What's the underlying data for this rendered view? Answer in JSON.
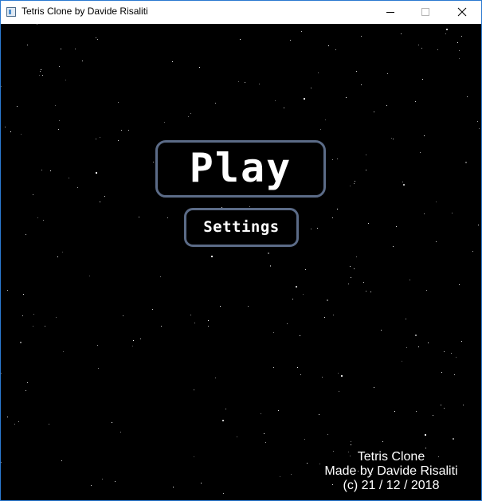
{
  "window": {
    "title": "Tetris Clone by Davide Risaliti",
    "icons": {
      "app": "app-window-icon",
      "minimize": "minimize-icon",
      "maximize": "maximize-icon",
      "close": "close-icon"
    }
  },
  "menu": {
    "play_label": "Play",
    "settings_label": "Settings"
  },
  "credits": {
    "line1": "Tetris Clone",
    "line2": "Made by Davide Risaliti",
    "line3": "(c) 21 / 12 / 2018"
  },
  "colors": {
    "background": "#000000",
    "button_border": "#5b6b87",
    "text": "#ffffff",
    "window_border": "#2b79d0"
  }
}
